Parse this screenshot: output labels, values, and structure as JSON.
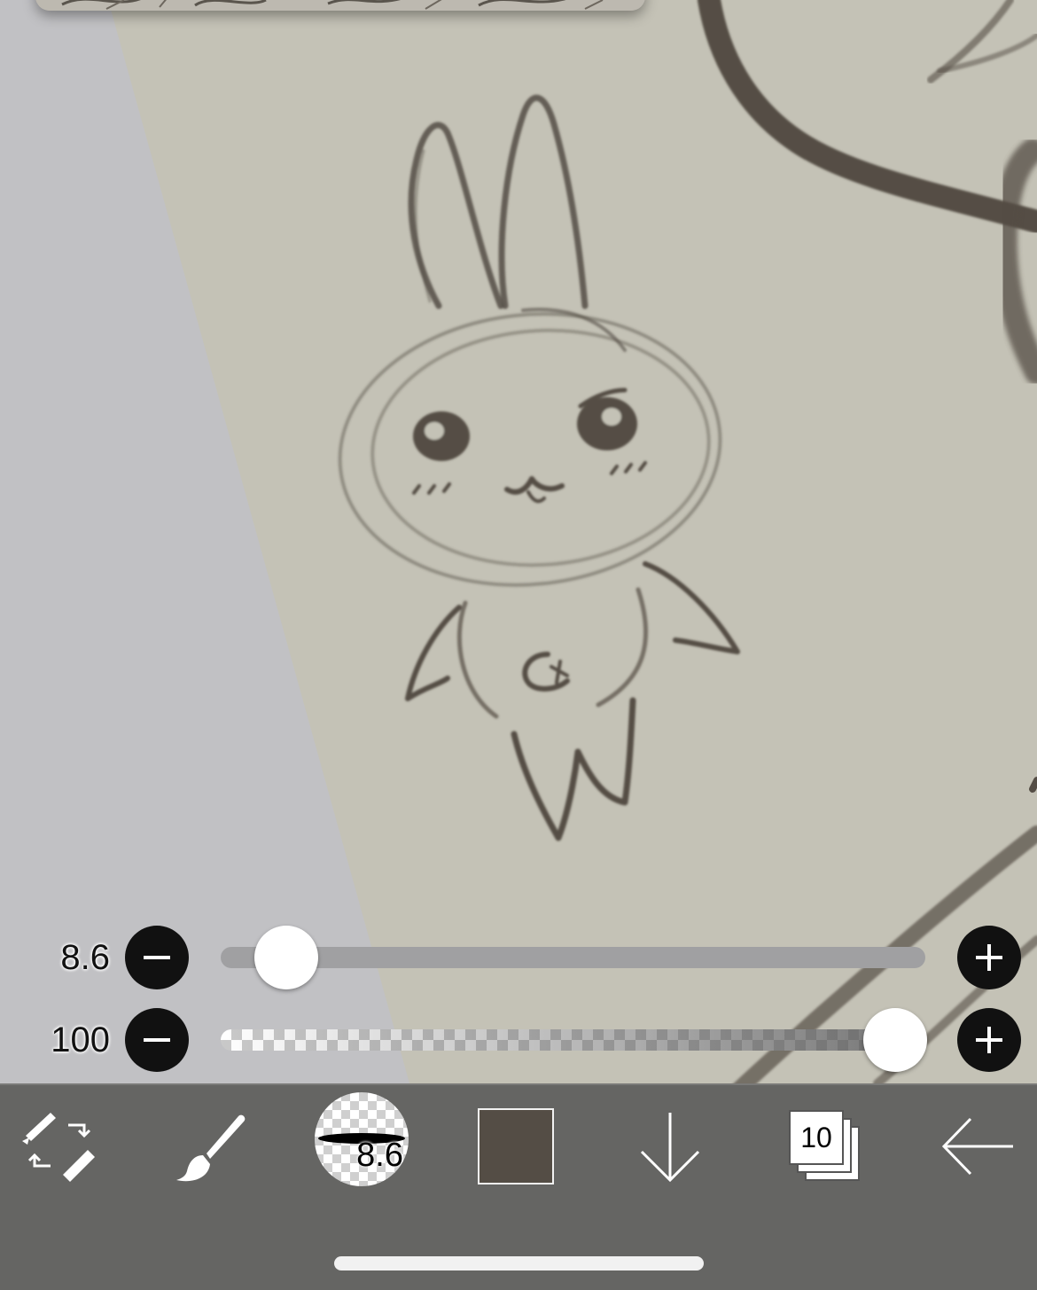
{
  "app": {
    "name": "drawing-canvas"
  },
  "colors": {
    "canvas_paper": "#c4c2b6",
    "canvas_outside": "#c1c1c4",
    "ink": "#544d45",
    "toolbar_bg": "#656563",
    "slider_button": "#111111"
  },
  "sliders": {
    "brush_size": {
      "value_label": "8.6",
      "value": 8.6,
      "fraction": 0.05,
      "minus_icon": "minus-icon",
      "plus_icon": "plus-icon"
    },
    "opacity": {
      "value_label": "100",
      "value": 100,
      "fraction": 1.0,
      "minus_icon": "minus-icon",
      "plus_icon": "plus-icon"
    }
  },
  "toolbar": {
    "tools": [
      {
        "name": "tool-switch",
        "icon": "brush-eraser-swap-icon"
      },
      {
        "name": "brush",
        "icon": "paintbrush-icon"
      },
      {
        "name": "brush-settings",
        "icon": "brush-preview",
        "size_label": "8.6"
      },
      {
        "name": "color",
        "icon": "color-swatch",
        "color": "#544d45"
      },
      {
        "name": "download",
        "icon": "arrow-down-icon"
      },
      {
        "name": "layers",
        "icon": "layers-icon",
        "count_label": "10"
      },
      {
        "name": "back",
        "icon": "arrow-left-icon"
      }
    ]
  }
}
